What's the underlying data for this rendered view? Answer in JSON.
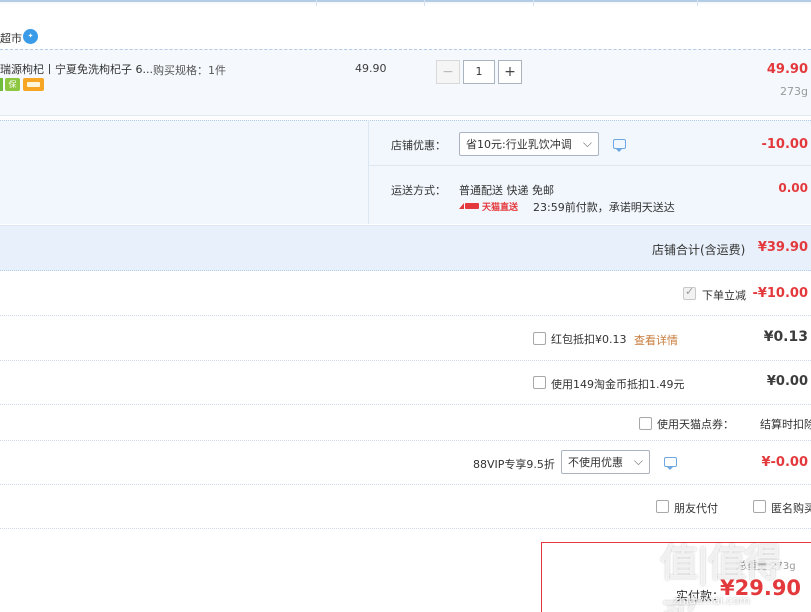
{
  "shop": {
    "name_fragment": "超市"
  },
  "item": {
    "title": "瑞源枸杞丨宁夏免洗枸杞子 6...",
    "spec_label": "购买规格：1件",
    "unit_price": "49.90",
    "quantity": "1",
    "subtotal": "49.90",
    "weight": "273g"
  },
  "shop_discount": {
    "label": "店铺优惠：",
    "selected": "省10元:行业乳饮冲调",
    "amount": "-10.00"
  },
  "shipping": {
    "label": "运送方式：",
    "method": "普通配送 快递 免邮",
    "badge": "天猫直送",
    "promise": "23:59前付款，承诺明天送达",
    "amount": "0.00"
  },
  "shop_total": {
    "label": "店铺合计(含运费)",
    "amount": "¥39.90"
  },
  "options": {
    "instant_discount": {
      "label": "下单立减",
      "amount": "-¥10.00"
    },
    "red_packet": {
      "label": "红包抵扣¥0.13",
      "link": "查看详情",
      "amount": "¥0.13"
    },
    "taobao_coins": {
      "label": "使用149淘金币抵扣1.49元",
      "amount": "¥0.00"
    },
    "tmall_points": {
      "label": "使用天猫点券：",
      "note": "结算时扣除"
    },
    "vip88": {
      "label": "88VIP专享9.5折",
      "selected": "不使用优惠",
      "amount": "¥-0.00"
    },
    "friend_pay": {
      "label": "朋友代付"
    },
    "anonymous": {
      "label": "匿名购买"
    }
  },
  "summary": {
    "weight_label": "总重量",
    "weight": "273g",
    "pay_label": "实付款：",
    "pay_amount": "¥29.90"
  },
  "watermark": "值|值得买",
  "watermark_url": "zhidemai.com",
  "colors": {
    "accent_red": "#e4393c",
    "row_blue": "#f2f7fd",
    "border_blue": "#b3cbe3"
  }
}
